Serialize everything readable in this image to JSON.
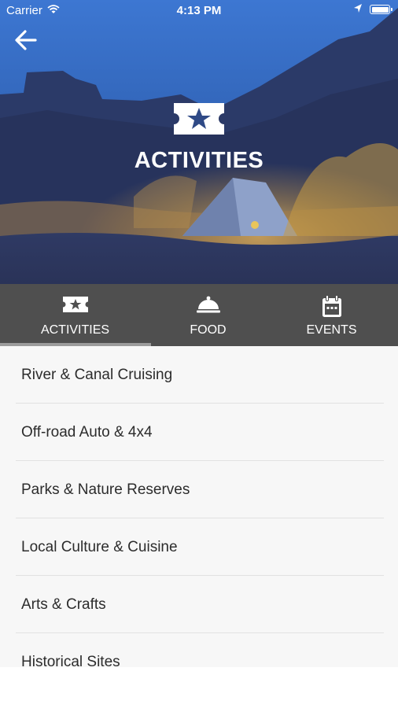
{
  "status_bar": {
    "carrier": "Carrier",
    "time": "4:13 PM",
    "wifi_icon": "wifi-icon",
    "location_icon": "location-arrow-icon",
    "battery_icon": "battery-icon"
  },
  "header": {
    "back_icon": "arrow-left-icon",
    "section_icon": "ticket-star-icon",
    "title": "ACTIVITIES"
  },
  "tabs": [
    {
      "label": "ACTIVITIES",
      "icon": "ticket-star-icon",
      "selected": true
    },
    {
      "label": "FOOD",
      "icon": "cloche-icon",
      "selected": false
    },
    {
      "label": "EVENTS",
      "icon": "calendar-icon",
      "selected": false
    }
  ],
  "list": {
    "items": [
      {
        "label": "River & Canal Cruising"
      },
      {
        "label": "Off-road Auto & 4x4"
      },
      {
        "label": "Parks & Nature Reserves"
      },
      {
        "label": "Local Culture & Cuisine"
      },
      {
        "label": "Arts & Crafts"
      },
      {
        "label": "Historical Sites"
      }
    ]
  },
  "colors": {
    "tab_bar": "#4f4f4f",
    "tab_underline": "#9c9c9c",
    "list_background": "#f7f7f7",
    "hero_sky": "#3a6fc8",
    "hero_shadow": "#1f2a4c"
  }
}
